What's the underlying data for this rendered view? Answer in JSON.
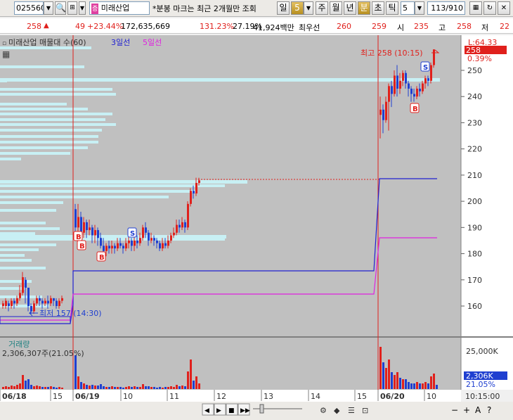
{
  "toolbar": {
    "code": "025560",
    "name": "미래산업",
    "notice": "*분봉 마크는 최근 2개월만 조회",
    "period_label": "일",
    "period_value": "5",
    "tab_week": "주",
    "tab_month": "월",
    "tab_year": "년",
    "tab_minute": "분",
    "tab_second": "초",
    "tab_tick": "틱",
    "interval_value": "5",
    "page_count": "113/910"
  },
  "quote": {
    "price": "258",
    "change": "49",
    "change_pct": "+23.44%",
    "volume": "172,635,669",
    "volume_ratio": "131.23%",
    "turnover": "27.19%",
    "amount": "41,924백만",
    "best_label": "최우선",
    "best_price": "260",
    "open_val": "259",
    "open_label": "시",
    "open_price": "235",
    "high_label": "고",
    "high_price": "258",
    "low_label": "저",
    "low_price": "22"
  },
  "chart_data": {
    "type": "candlestick",
    "title": "미래산업 매물대 수(60)",
    "legend": [
      {
        "name": "3일선",
        "color": "#2020d0"
      },
      {
        "name": "5일선",
        "color": "#e020e0"
      }
    ],
    "y_axis": {
      "ticks": [
        "250",
        "240",
        "230",
        "220",
        "210",
        "200",
        "190",
        "180",
        "170",
        "160"
      ]
    },
    "last_price_box": "258",
    "high_label_top": "L:64.33",
    "pct_label": "0.39%",
    "annotation_high": "최고 258 (10:15)",
    "annotation_low": "최저 157 (14:30)",
    "volume_panel": {
      "title": "거래량",
      "subtitle": "2,306,307주(21.05%)",
      "axis_label": "25,000K",
      "last_volume": "2,306K",
      "last_pct": "21.05%"
    },
    "x_labels": [
      "06/18",
      "15",
      "06/19",
      "10",
      "11",
      "12",
      "13",
      "14",
      "15",
      "06/20",
      "10"
    ],
    "time_label": "10:15:00",
    "ma3_levels": [
      155,
      174,
      174,
      209
    ],
    "ma5_levels": [
      155,
      166,
      166,
      186
    ],
    "markers": [
      "B",
      "B",
      "B",
      "S",
      "S",
      "B"
    ]
  },
  "colors": {
    "up": "#e0201c",
    "down": "#1f3fd0",
    "background": "#c0c0c0",
    "volume_profile": "#c8f0f4"
  },
  "bottom_toolbar": {
    "symbols": [
      "◀",
      "▶",
      "■",
      "▶▶"
    ],
    "right_icons": [
      "−",
      "+",
      "A",
      "?"
    ]
  }
}
